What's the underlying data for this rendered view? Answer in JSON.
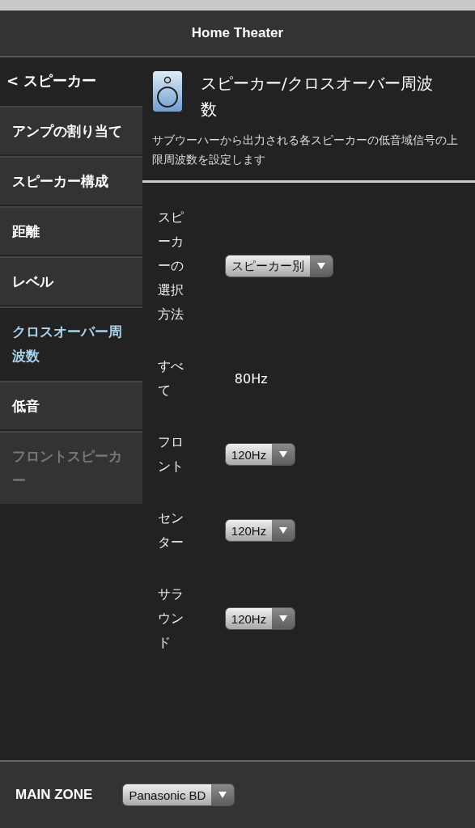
{
  "header": {
    "title": "Home Theater"
  },
  "sidebar": {
    "back": "< スピーカー",
    "items": [
      {
        "label": "アンプの割り当て",
        "selected": false,
        "disabled": false
      },
      {
        "label": "スピーカー構成",
        "selected": false,
        "disabled": false
      },
      {
        "label": "距離",
        "selected": false,
        "disabled": false
      },
      {
        "label": "レベル",
        "selected": false,
        "disabled": false
      },
      {
        "label": "クロスオーバー周波数",
        "selected": true,
        "disabled": false
      },
      {
        "label": "低音",
        "selected": false,
        "disabled": false
      },
      {
        "label": "フロントスピーカー",
        "selected": false,
        "disabled": true
      }
    ]
  },
  "content": {
    "title": "スピーカー/クロスオーバー周波数",
    "description": "サブウーハーから出力される各スピーカーの低音域信号の上限周波数を設定します",
    "settings": [
      {
        "kind": "dropdown",
        "label": "スピーカーの選択方法",
        "value": "スピーカー別"
      },
      {
        "kind": "value",
        "label": "すべて",
        "value": "80Hz"
      },
      {
        "kind": "dropdown",
        "label": "フロント",
        "value": "120Hz"
      },
      {
        "kind": "dropdown",
        "label": "センター",
        "value": "120Hz"
      },
      {
        "kind": "dropdown",
        "label": "サラウンド",
        "value": "120Hz"
      }
    ]
  },
  "footer": {
    "zone": "MAIN ZONE",
    "source": "Panasonic BD"
  }
}
